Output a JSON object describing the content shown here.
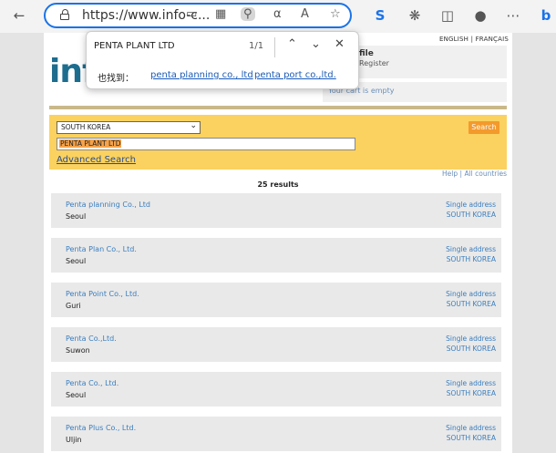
{
  "browser": {
    "url": "https://www.info-c..."
  },
  "find_bar": {
    "query": "PENTA PLANT LTD",
    "match_count": "1/1",
    "also_find_label": "也找到：",
    "suggestions": [
      "penta planning co., ltd",
      "penta port co.,ltd."
    ]
  },
  "header": {
    "logo_text": "inf",
    "lang_english": "English",
    "lang_sep": "|",
    "lang_french": "Français",
    "profile_title": "file",
    "register_link": "Register",
    "cart_text": "Your cart is empty"
  },
  "search": {
    "country": "SOUTH KOREA",
    "query": "PENTA PLANT LTD",
    "advanced_link": "Advanced Search",
    "search_button": "Search",
    "help_link": "Help",
    "help_sep": "|",
    "all_countries_link": "All countries",
    "results_count": "25 results"
  },
  "results": [
    {
      "name": "Penta planning Co., Ltd",
      "city": "Seoul",
      "type": "Single address",
      "country": "SOUTH KOREA"
    },
    {
      "name": "Penta Plan Co., Ltd.",
      "city": "Seoul",
      "type": "Single address",
      "country": "SOUTH KOREA"
    },
    {
      "name": "Penta Point Co., Ltd.",
      "city": "Guri",
      "type": "Single address",
      "country": "SOUTH KOREA"
    },
    {
      "name": "Penta Co.,Ltd.",
      "city": "Suwon",
      "type": "Single address",
      "country": "SOUTH KOREA"
    },
    {
      "name": "Penta Co., Ltd.",
      "city": "Seoul",
      "type": "Single address",
      "country": "SOUTH KOREA"
    },
    {
      "name": "Penta Plus Co., Ltd.",
      "city": "Uljin",
      "type": "Single address",
      "country": "SOUTH KOREA"
    }
  ]
}
